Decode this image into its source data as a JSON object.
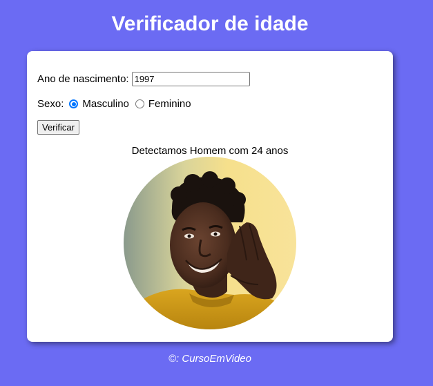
{
  "header": {
    "title": "Verificador de idade"
  },
  "form": {
    "year_label": "Ano de nascimento:",
    "year_value": "1997",
    "sex_label": "Sexo:",
    "sex_options": [
      {
        "label": "Masculino",
        "checked": true
      },
      {
        "label": "Feminino",
        "checked": false
      }
    ],
    "verify_label": "Verificar"
  },
  "result": {
    "text": "Detectamos Homem com 24 anos",
    "image_subject": "smiling young man in yellow sweater"
  },
  "footer": {
    "text": "©: CursoEmVideo"
  },
  "colors": {
    "background": "#6b6bf3",
    "card": "#ffffff",
    "radio_accent": "#0075ff"
  }
}
